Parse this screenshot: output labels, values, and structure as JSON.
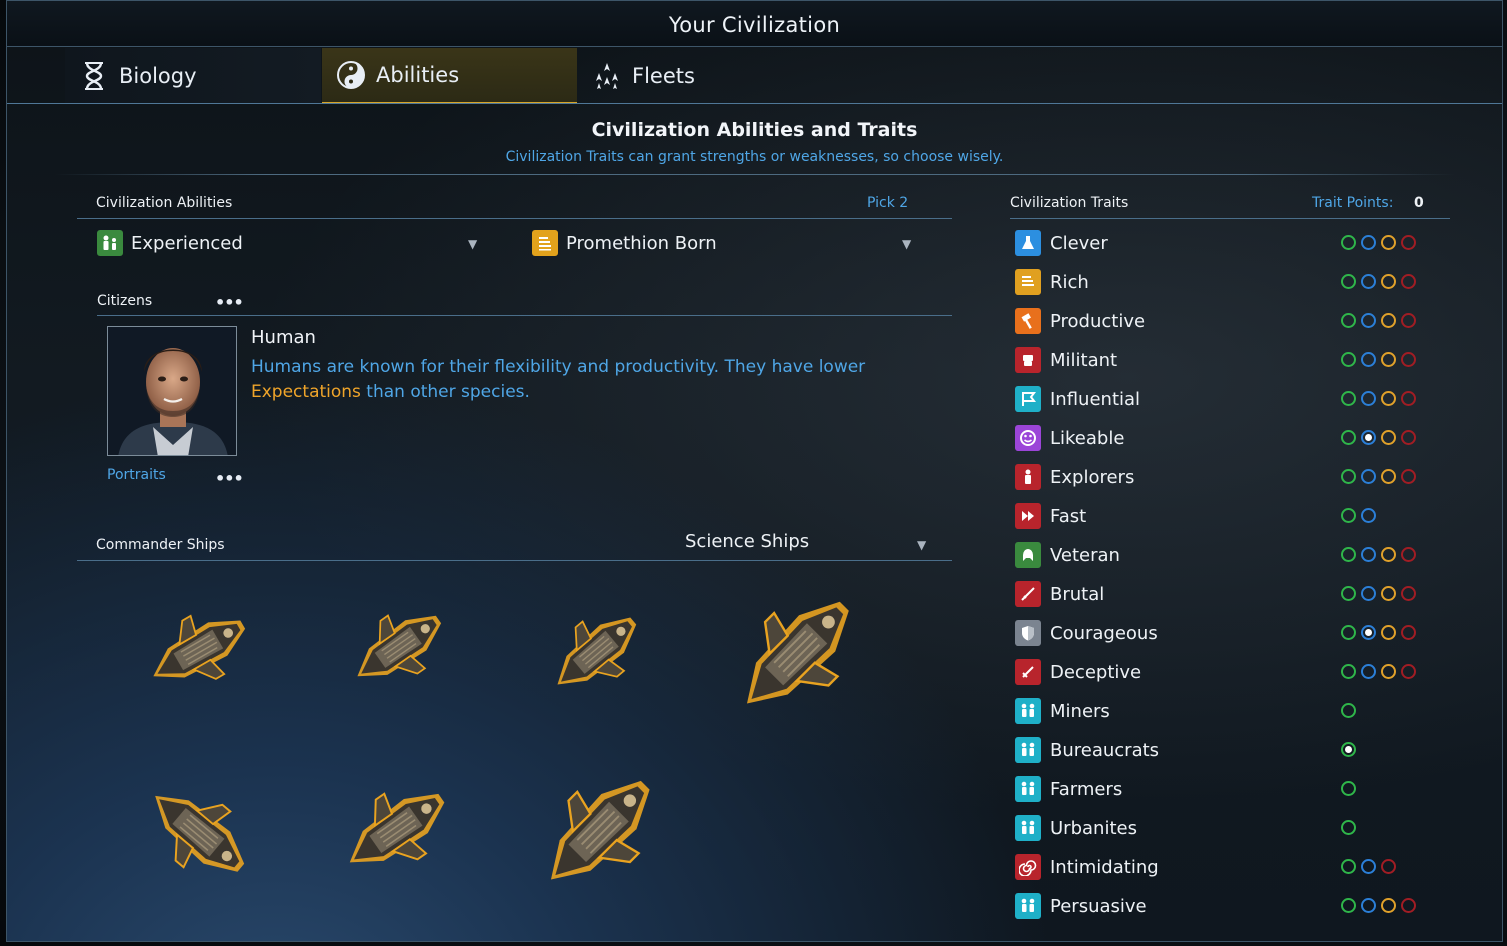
{
  "window": {
    "title": "Your Civilization"
  },
  "tabs": [
    {
      "label": "Biology",
      "icon": "dna-icon"
    },
    {
      "label": "Abilities",
      "icon": "yin-yang-icon",
      "active": true
    },
    {
      "label": "Fleets",
      "icon": "fleet-icon"
    }
  ],
  "header": {
    "title": "Civilization Abilities and Traits",
    "subtitle": "Civilization Traits can grant strengths or weaknesses, so choose wisely."
  },
  "abilities": {
    "label": "Civilization Abilities",
    "pick": "Pick 2",
    "selected": [
      {
        "label": "Experienced",
        "icon": "experienced-icon",
        "color": "#3a8a3e"
      },
      {
        "label": "Promethion Born",
        "icon": "promethion-icon",
        "color": "#e2a21c"
      }
    ]
  },
  "citizens": {
    "label": "Citizens",
    "more": "•••",
    "species": "Human",
    "desc_part1": "Humans are known for their flexibility and productivity. They have lower ",
    "desc_highlight": "Expectations",
    "desc_part2": " than other species.",
    "portraits_label": "Portraits",
    "portraits_more": "•••"
  },
  "commander_ships": {
    "label": "Commander Ships",
    "selected": "Science Ships",
    "count": 7
  },
  "traits": {
    "label": "Civilization Traits",
    "points_label": "Trait Points:",
    "points_value": "0",
    "items": [
      {
        "label": "Clever",
        "icon": "flask-icon",
        "color": "#2c8fe0",
        "circles": [
          "g",
          "b",
          "o",
          "r"
        ],
        "selected": -1
      },
      {
        "label": "Rich",
        "icon": "coins-icon",
        "color": "#e0a020",
        "circles": [
          "g",
          "b",
          "o",
          "r"
        ],
        "selected": -1
      },
      {
        "label": "Productive",
        "icon": "hammer-icon",
        "color": "#e8701c",
        "circles": [
          "g",
          "b",
          "o",
          "r"
        ],
        "selected": -1
      },
      {
        "label": "Militant",
        "icon": "fist-icon",
        "color": "#b8242c",
        "circles": [
          "g",
          "b",
          "o",
          "r"
        ],
        "selected": -1
      },
      {
        "label": "Influential",
        "icon": "flag-icon",
        "color": "#1fb0c8",
        "circles": [
          "g",
          "b",
          "o",
          "r"
        ],
        "selected": -1
      },
      {
        "label": "Likeable",
        "icon": "smile-icon",
        "color": "#9b45d8",
        "circles": [
          "g",
          "b",
          "o",
          "r"
        ],
        "selected": 1
      },
      {
        "label": "Explorers",
        "icon": "explorer-icon",
        "color": "#b8242c",
        "circles": [
          "g",
          "b",
          "o",
          "r"
        ],
        "selected": -1
      },
      {
        "label": "Fast",
        "icon": "fast-forward-icon",
        "color": "#b8242c",
        "circles": [
          "g",
          "b"
        ],
        "selected": -1
      },
      {
        "label": "Veteran",
        "icon": "helmet-icon",
        "color": "#3a8a3e",
        "circles": [
          "g",
          "b",
          "o",
          "r"
        ],
        "selected": -1
      },
      {
        "label": "Brutal",
        "icon": "sword-icon",
        "color": "#b8242c",
        "circles": [
          "g",
          "b",
          "o",
          "r"
        ],
        "selected": -1
      },
      {
        "label": "Courageous",
        "icon": "shield-icon",
        "color": "#7b8490",
        "circles": [
          "g",
          "b",
          "o",
          "r"
        ],
        "selected": 1
      },
      {
        "label": "Deceptive",
        "icon": "dagger-icon",
        "color": "#b8242c",
        "circles": [
          "g",
          "b",
          "o",
          "r"
        ],
        "selected": -1
      },
      {
        "label": "Miners",
        "icon": "people-icon",
        "color": "#1fb0c8",
        "circles": [
          "g"
        ],
        "selected": -1
      },
      {
        "label": "Bureaucrats",
        "icon": "people-icon",
        "color": "#1fb0c8",
        "circles": [
          "g"
        ],
        "selected": 0
      },
      {
        "label": "Farmers",
        "icon": "people-icon",
        "color": "#1fb0c8",
        "circles": [
          "g"
        ],
        "selected": -1
      },
      {
        "label": "Urbanites",
        "icon": "people-icon",
        "color": "#1fb0c8",
        "circles": [
          "g"
        ],
        "selected": -1
      },
      {
        "label": "Intimidating",
        "icon": "spiral-icon",
        "color": "#b8242c",
        "circles": [
          "g",
          "b",
          "r"
        ],
        "selected": -1
      },
      {
        "label": "Persuasive",
        "icon": "people-icon",
        "color": "#1fb0c8",
        "circles": [
          "g",
          "b",
          "o",
          "r"
        ],
        "selected": -1
      }
    ]
  },
  "colors": {
    "accent_blue": "#4fa6e6",
    "accent_gold": "#d6a52a",
    "highlight_orange": "#f0a52a"
  }
}
